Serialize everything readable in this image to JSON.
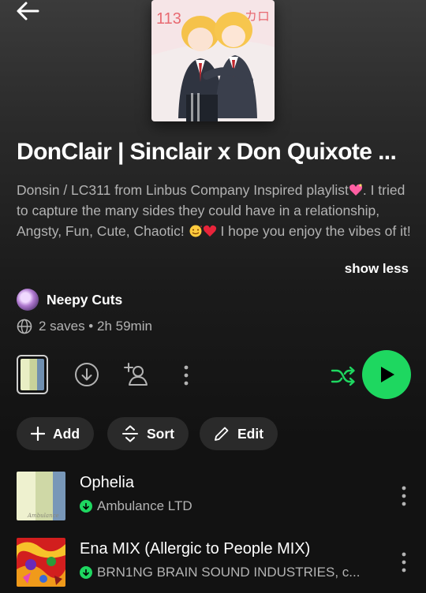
{
  "header": {
    "back_icon": "arrow-left-icon"
  },
  "playlist": {
    "title": "DonClair | Sinclair x Don Quixote ...",
    "description_1": "Donsin / LC311 from Linbus Company Inspired playlist",
    "description_2": ". I tried to capture the many sides they could have in a relationship, Angsty, Fun, Cute, Chaotic!",
    "description_3": " I hope you enjoy the vibes of it!",
    "show_less": "show less",
    "owner": "Neepy Cuts",
    "meta": "2 saves • 2h 59min",
    "cover_text_left": "113",
    "cover_text_right": "カロ"
  },
  "actions": {
    "add": "Add",
    "sort": "Sort",
    "edit": "Edit"
  },
  "tracks": [
    {
      "title": "Ophelia",
      "artist": "Ambulance LTD",
      "art_text": "Ambulance"
    },
    {
      "title": "Ena MIX (Allergic to People MIX)",
      "artist": "BRN1NG BRAIN SOUND INDUSTRIES, c..."
    }
  ],
  "colors": {
    "accent": "#1ed760",
    "muted": "#b3b3b3",
    "pill": "#2a2a2a"
  }
}
